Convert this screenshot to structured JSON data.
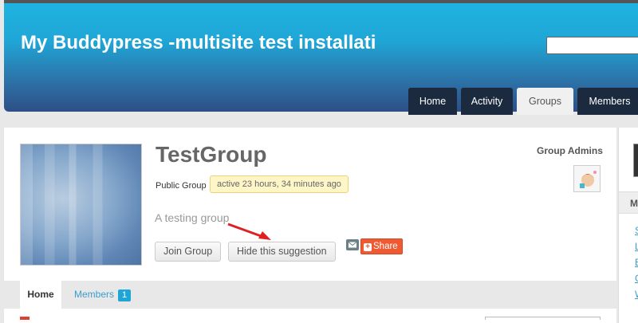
{
  "header": {
    "site_title": "My Buddypress -multisite test installati",
    "search_placeholder": "",
    "nav": [
      {
        "label": "Home",
        "active": false
      },
      {
        "label": "Activity",
        "active": false
      },
      {
        "label": "Groups",
        "active": true
      },
      {
        "label": "Members",
        "active": false
      }
    ]
  },
  "group": {
    "title": "TestGroup",
    "type": "Public Group",
    "activity": "active 23 hours, 34 minutes ago",
    "description": "A testing group",
    "join_label": "Join Group",
    "hide_label": "Hide this suggestion",
    "share_label": "Share",
    "admins_label": "Group Admins"
  },
  "subnav": {
    "home_label": "Home",
    "members_label": "Members",
    "members_count": "1"
  },
  "sidebar": {
    "heading_initial": "M",
    "links": [
      "S",
      "L",
      "E",
      "C",
      "W"
    ]
  },
  "colors": {
    "header_top": "#1fb3e1",
    "header_bottom": "#2d4f86",
    "nav_dark": "#1c2a3f",
    "share_orange": "#ef5a32",
    "link_blue": "#3a9dd0",
    "annotation_arrow": "#e02020"
  },
  "icons": [
    "mail-icon",
    "share-plus-icon",
    "annotation-arrow-icon"
  ]
}
